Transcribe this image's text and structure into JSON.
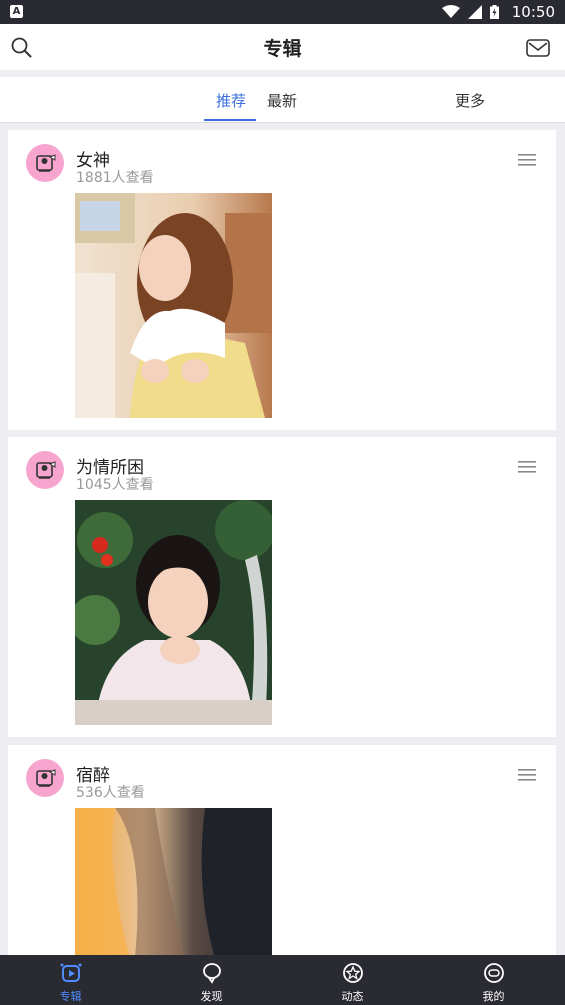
{
  "status_bar": {
    "time": "10:50",
    "app_badge": "A"
  },
  "header": {
    "title": "专辑"
  },
  "tabs": [
    {
      "label": "推荐",
      "active": true
    },
    {
      "label": "最新",
      "active": false
    },
    {
      "label": "更多",
      "active": false
    }
  ],
  "albums": [
    {
      "title": "女神",
      "views": "1881人查看"
    },
    {
      "title": "为情所困",
      "views": "1045人查看"
    },
    {
      "title": "宿醉",
      "views": "536人查看"
    }
  ],
  "bottom_nav": [
    {
      "label": "专辑",
      "icon": "album-play-icon",
      "active": true
    },
    {
      "label": "发现",
      "icon": "discover-bubble-icon",
      "active": false
    },
    {
      "label": "动态",
      "icon": "star-badge-icon",
      "active": false
    },
    {
      "label": "我的",
      "icon": "profile-face-icon",
      "active": false
    }
  ],
  "colors": {
    "accent": "#3b6fe0",
    "nav_active": "#4f8cff",
    "nav_bg": "#2a2a33",
    "avatar_bg": "#f7a5cf"
  }
}
